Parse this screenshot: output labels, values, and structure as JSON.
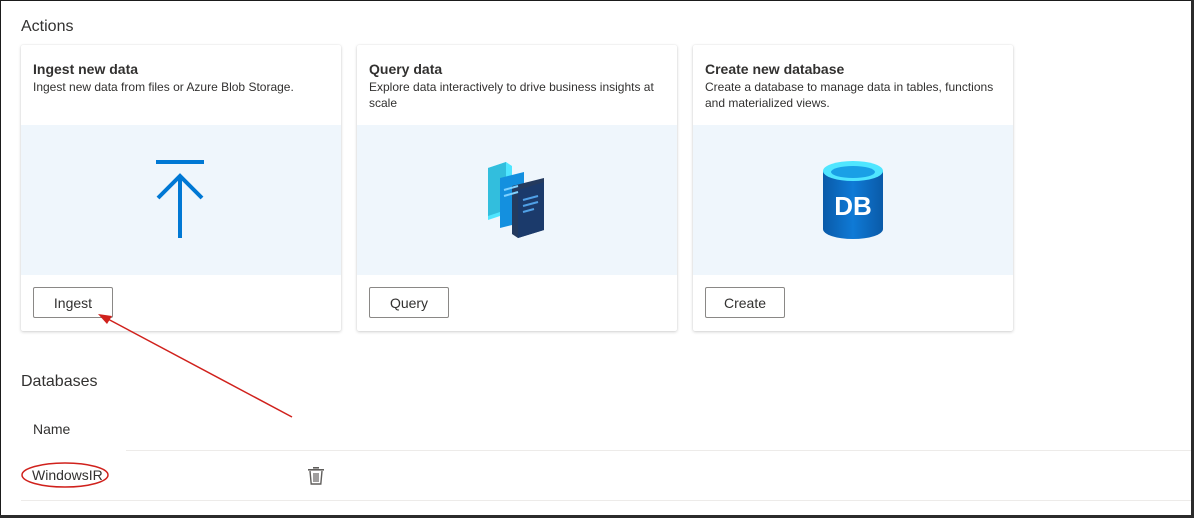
{
  "sections": {
    "actions_title": "Actions",
    "databases_title": "Databases"
  },
  "cards": {
    "ingest": {
      "title": "Ingest new data",
      "description": "Ingest new data from files or Azure Blob Storage.",
      "button": "Ingest",
      "icon": "upload-arrow-icon"
    },
    "query": {
      "title": "Query data",
      "description": "Explore data interactively to drive business insights at scale",
      "button": "Query",
      "icon": "query-documents-icon"
    },
    "create": {
      "title": "Create new database",
      "description": "Create a database to manage data in tables, functions and materialized views.",
      "button": "Create",
      "icon": "database-db-icon",
      "icon_text": "DB"
    }
  },
  "table": {
    "columns": [
      "Name"
    ],
    "rows": [
      {
        "name": "WindowsIR",
        "action_icon": "trash-icon"
      }
    ]
  },
  "colors": {
    "accent": "#0078d4",
    "illustration_bg": "#eff6fc",
    "annotation_red": "#d0211c"
  }
}
